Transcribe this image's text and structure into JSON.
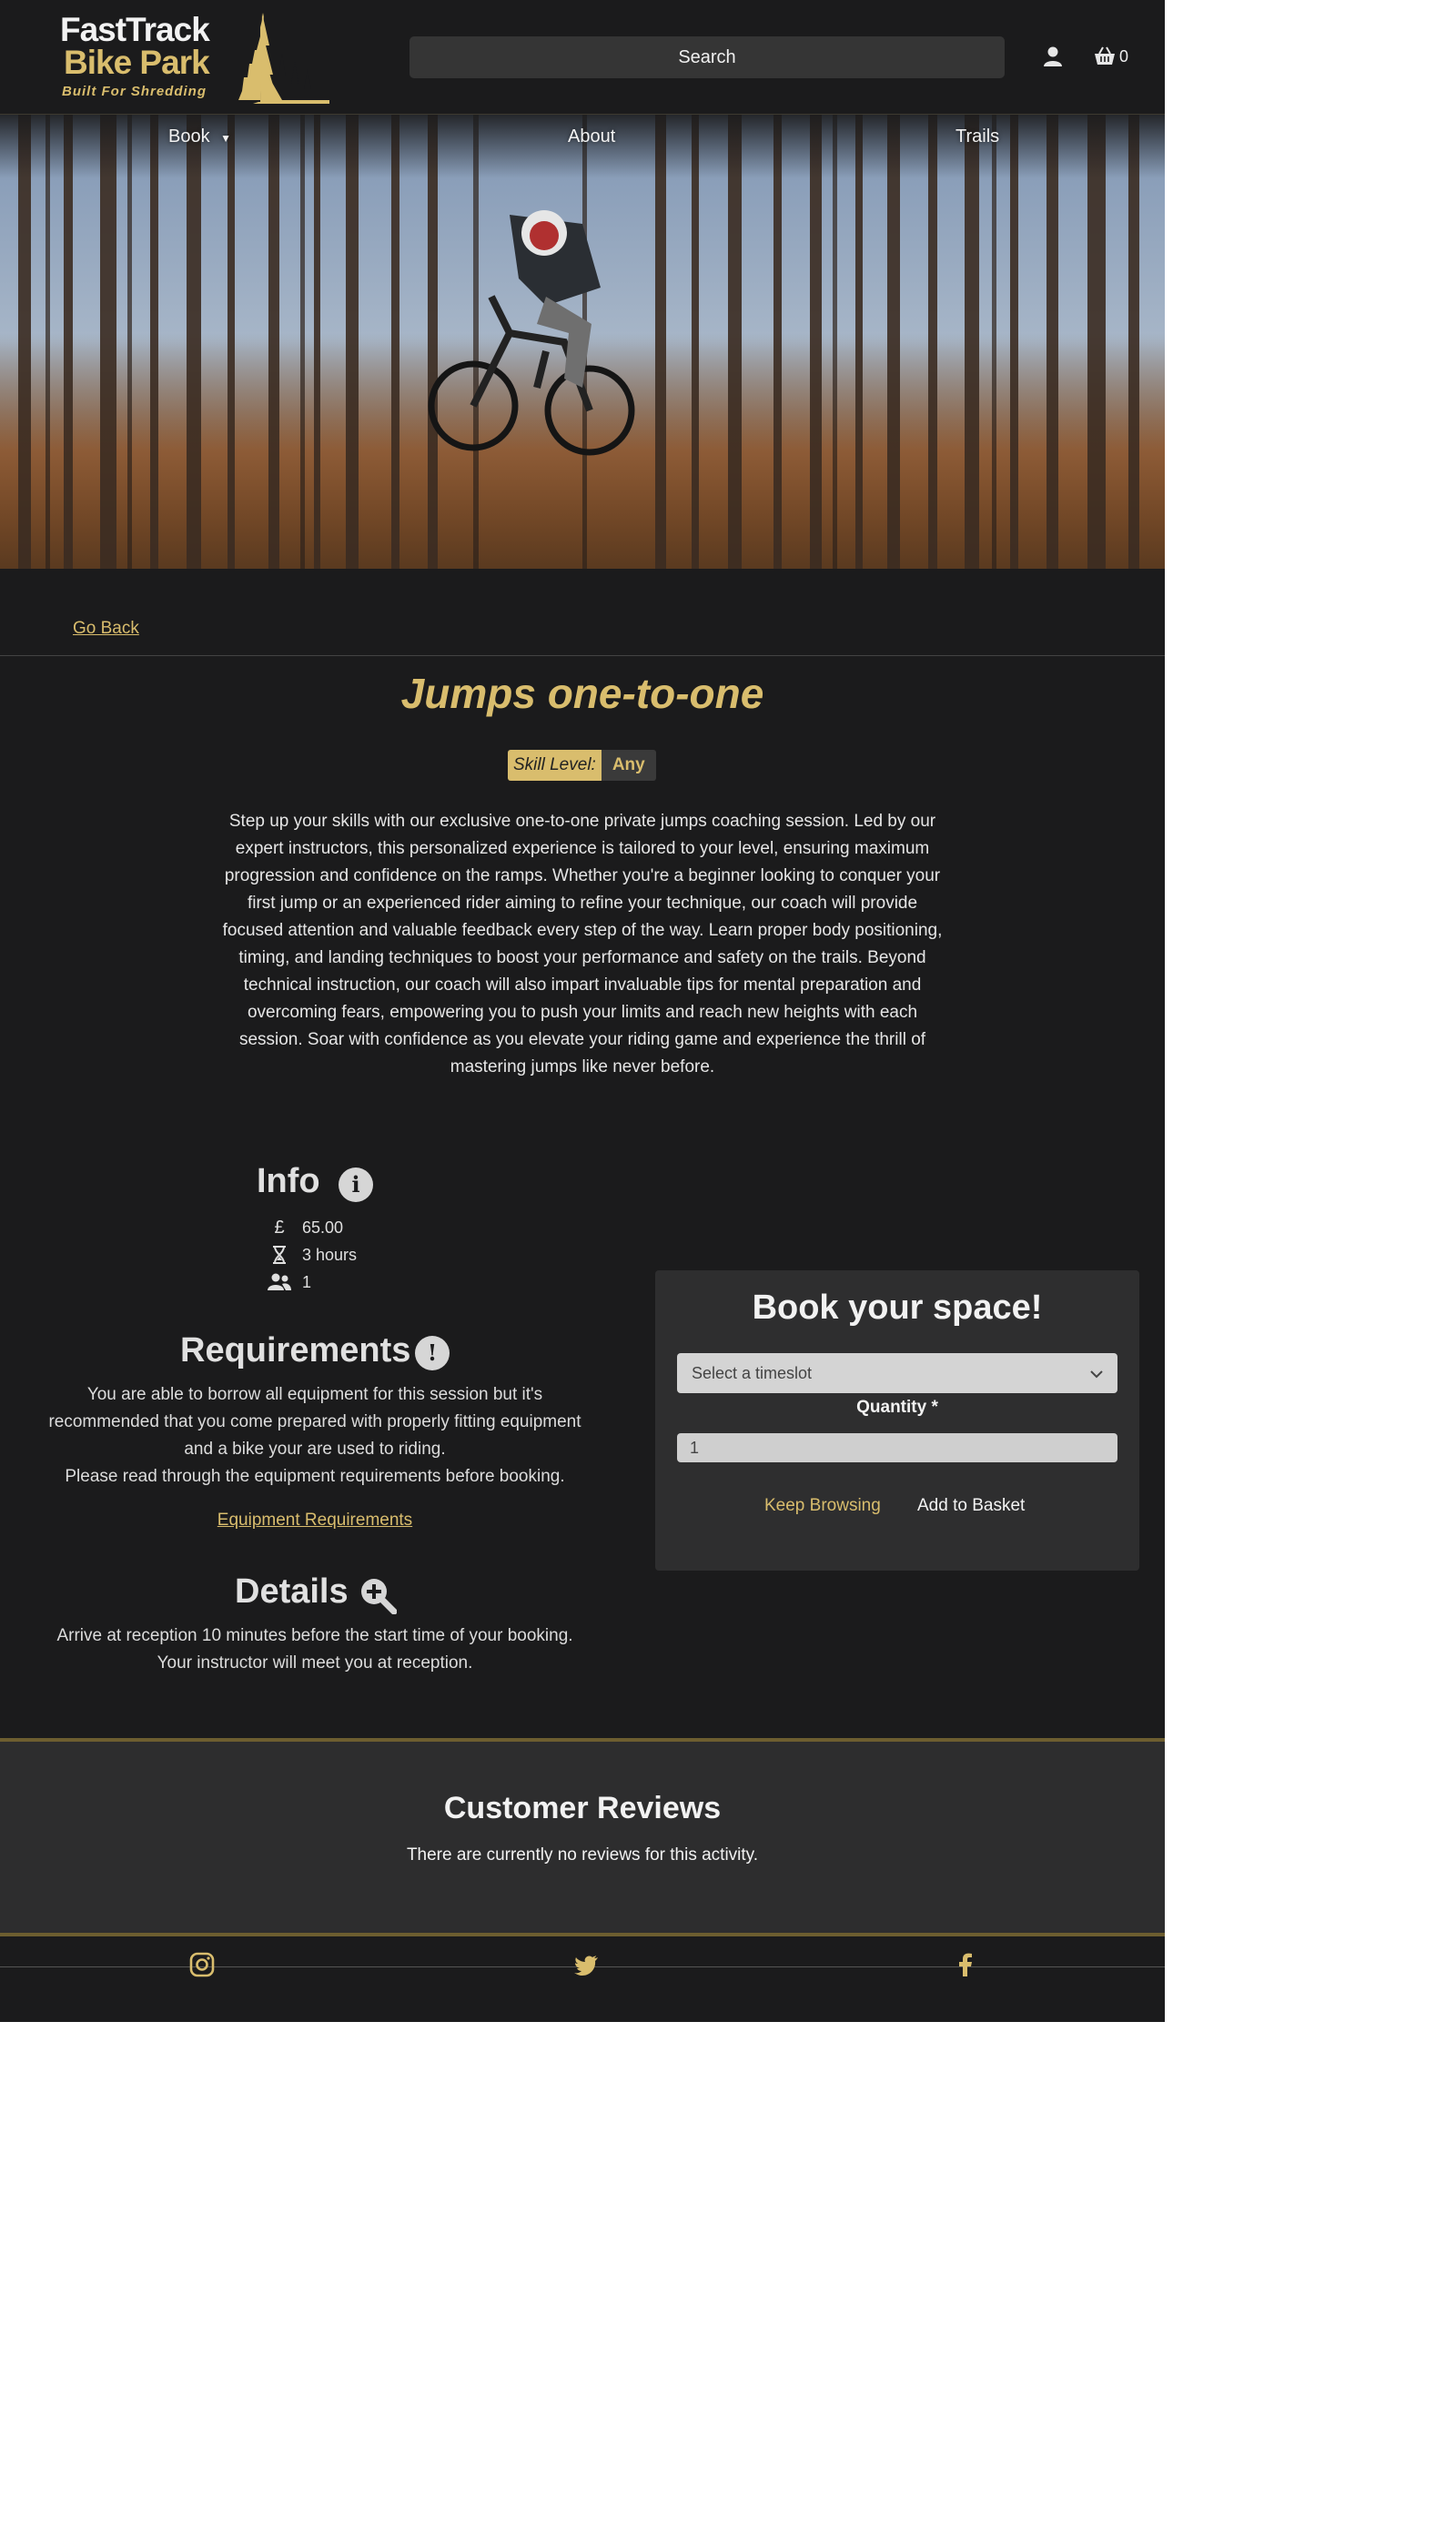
{
  "header": {
    "logo_line1": "FastTrack",
    "logo_line2": "Bike Park",
    "logo_tagline": "Built For Shredding",
    "search_placeholder": "Search",
    "cart_count": "0"
  },
  "nav": {
    "book": "Book",
    "about": "About",
    "trails": "Trails"
  },
  "go_back": "Go Back",
  "activity": {
    "title": "Jumps one-to-one",
    "skill_label": "Skill Level:",
    "skill_value": "Any",
    "description": "Step up your skills with our exclusive one-to-one private jumps coaching session. Led by our expert instructors, this personalized experience is tailored to your level, ensuring maximum progression and confidence on the ramps. Whether you're a beginner looking to conquer your first jump or an experienced rider aiming to refine your technique, our coach will provide focused attention and valuable feedback every step of the way. Learn proper body positioning, timing, and landing techniques to boost your performance and safety on the trails. Beyond technical instruction, our coach will also impart invaluable tips for mental preparation and overcoming fears, empowering you to push your limits and reach new heights with each session. Soar with confidence as you elevate your riding game and experience the thrill of mastering jumps like never before."
  },
  "info": {
    "heading": "Info",
    "price_symbol": "£",
    "price": "65.00",
    "duration": "3 hours",
    "capacity": "1"
  },
  "requirements": {
    "heading": "Requirements",
    "text_1": "You are able to borrow all equipment for this session but it's recommended that you come prepared with properly fitting equipment and a bike your are used to riding.",
    "text_2": "Please read through the equipment requirements before booking.",
    "link": "Equipment Requirements"
  },
  "details": {
    "heading": "Details",
    "line_1": "Arrive at reception 10 minutes before the start time of your booking.",
    "line_2": "Your instructor will meet you at reception."
  },
  "booking": {
    "heading": "Book your space!",
    "timeslot_placeholder": "Select a timeslot",
    "quantity_label": "Quantity *",
    "quantity_value": "1",
    "keep_browsing": "Keep Browsing",
    "add_to_basket": "Add to Basket"
  },
  "reviews": {
    "heading": "Customer Reviews",
    "empty_text": "There are currently no reviews for this activity."
  },
  "colors": {
    "accent_gold": "#d9bd6d",
    "background": "#1b1b1c",
    "card": "#2e2e2f"
  },
  "icons": [
    "user-icon",
    "basket-icon",
    "caret-down-icon",
    "info-icon",
    "pound-icon",
    "hourglass-icon",
    "users-icon",
    "exclamation-icon",
    "magnify-plus-icon",
    "chevron-down-icon",
    "instagram-icon",
    "twitter-icon",
    "facebook-icon"
  ]
}
